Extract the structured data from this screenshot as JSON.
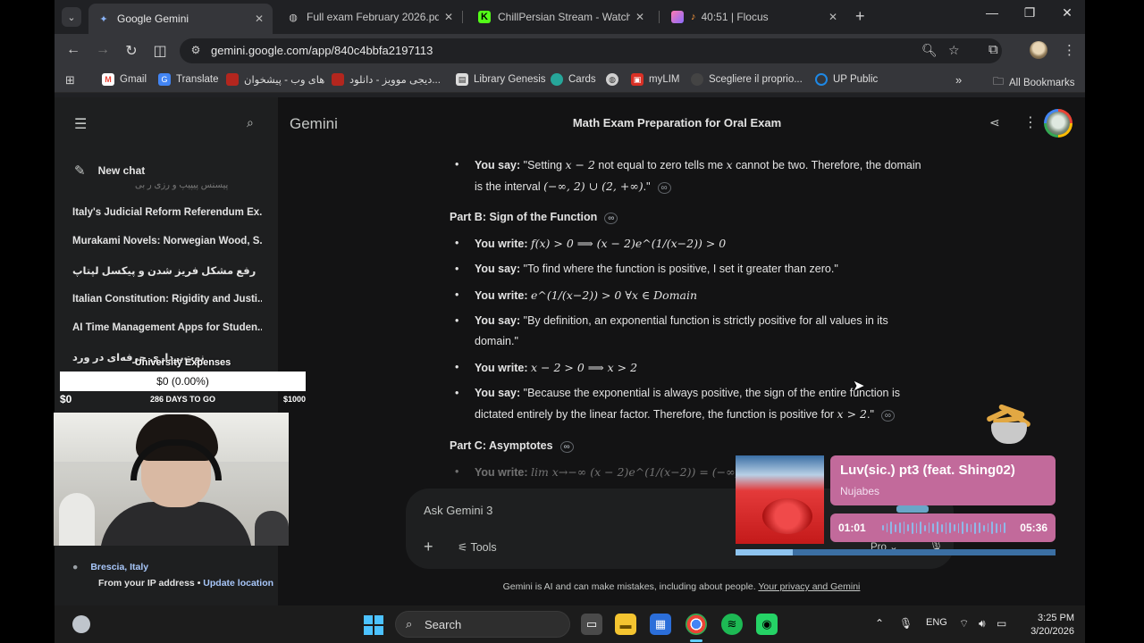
{
  "tabs": [
    {
      "label": "Google Gemini",
      "icon": "gemini-icon",
      "active": true
    },
    {
      "label": "Full exam February 2026.pdf",
      "icon": "globe-icon",
      "active": false
    },
    {
      "label": "ChillPersian Stream - Watch Live",
      "icon": "kick-icon",
      "active": false
    },
    {
      "label": "40:51 | Flocus",
      "icon": "flocus-icon",
      "active": false
    }
  ],
  "address_bar": {
    "url": "gemini.google.com/app/840c4bbfa2197113"
  },
  "bookmarks": [
    {
      "label": "Gmail",
      "icon": "gmail-icon"
    },
    {
      "label": "Translate",
      "icon": "translate-icon"
    },
    {
      "label": "های وب - پیشخوان",
      "icon": "bookmark-icon"
    },
    {
      "label": "دیجی موویز - دانلود...",
      "icon": "bookmark-icon"
    },
    {
      "label": "Library Genesis",
      "icon": "book-icon"
    },
    {
      "label": "Cards",
      "icon": "cards-icon"
    },
    {
      "label": "",
      "icon": "globe-icon"
    },
    {
      "label": "myLIM",
      "icon": "mylim-icon"
    },
    {
      "label": "Scegliere il proprio...",
      "icon": "bookmark-icon"
    },
    {
      "label": "UP Public",
      "icon": "up-icon"
    }
  ],
  "all_bookmarks_label": "All Bookmarks",
  "gemini": {
    "brand": "Gemini",
    "chat_title": "Math Exam Preparation for Oral Exam",
    "new_chat_label": "New chat",
    "recent_faded": "پیسنس پیپیپ و رزی ر بی",
    "recent_chats": [
      {
        "label": "Italy's Judicial Reform Referendum Ex...",
        "rtl": false
      },
      {
        "label": "Murakami Novels: Norwegian Wood, S...",
        "rtl": false
      },
      {
        "label": "رفع مشکل فریز شدن و پیکسل لپتاپ",
        "rtl": true
      },
      {
        "label": "Italian Constitution: Rigidity and Justi...",
        "rtl": false
      },
      {
        "label": "AI Time Management Apps for Studen...",
        "rtl": false
      },
      {
        "label": "نوت‌برداری حرفه‌ای در ورد",
        "rtl": true
      }
    ],
    "location": {
      "place": "Brescia, Italy",
      "from_ip": "From your IP address",
      "separator": "•",
      "update": "Update location"
    },
    "input_placeholder": "Ask Gemini 3",
    "tools_label": "Tools",
    "mode_label": "Pro",
    "disclaimer": "Gemini is AI and can make mistakes, including about people.",
    "privacy_link": "Your privacy and Gemini"
  },
  "content": {
    "bullet1": {
      "prefix": "You say:",
      "text1": " \"Setting ",
      "m1": "x − 2",
      "text2": " not equal to zero tells me ",
      "m2": "x",
      "text3": " cannot be two. Therefore, the domain",
      "text4": "is the interval ",
      "m3": "(−∞, 2) ∪ (2, +∞)",
      "text5": ".\""
    },
    "partB": "Part B: Sign of the Function",
    "b1": {
      "prefix": "You write:",
      "math": "f(x) > 0 ⟹ (x − 2)e^(1/(x−2)) > 0"
    },
    "b2": {
      "prefix": "You say:",
      "text": "\"To find where the function is positive, I set it greater than zero.\""
    },
    "b3": {
      "prefix": "You write:",
      "math": "e^(1/(x−2)) > 0   ∀x ∈ Domain"
    },
    "b4": {
      "prefix": "You say:",
      "text1": "\"By definition, an exponential function is strictly positive for all values in its",
      "text2": "domain.\""
    },
    "b5": {
      "prefix": "You write:",
      "math": "x − 2 > 0 ⟹ x > 2"
    },
    "b6": {
      "prefix": "You say:",
      "text1": "\"Because the exponential is always positive, the sign of the entire function is",
      "text2": "dictated entirely by the linear factor. Therefore, the function is positive for ",
      "m": "x > 2",
      "text3": ".\""
    },
    "partC": "Part C: Asymptotes",
    "c1": {
      "prefix": "You write:",
      "math": "lim x→−∞ (x − 2)e^(1/(x−2)) = (−∞) · e"
    }
  },
  "expenses": {
    "title": "University Expenses",
    "amount": "$0 (0.00%)",
    "min": "$0",
    "days": "286 DAYS TO GO",
    "max": "$1000"
  },
  "music": {
    "track": "Luv(sic.) pt3 (feat. Shing02)",
    "artist": "Nujabes",
    "elapsed": "01:01",
    "total": "05:36",
    "progress": 0.18
  },
  "taskbar": {
    "search": "Search",
    "language": "ENG",
    "time": "3:25 PM",
    "date": "3/20/2026"
  },
  "colors": {
    "gemini_bg": "#131314",
    "sidebar_bg": "#1e1f20",
    "link": "#a8c7fa",
    "accent_pink": "#c26a9b",
    "progress": "#8ec4ef"
  }
}
